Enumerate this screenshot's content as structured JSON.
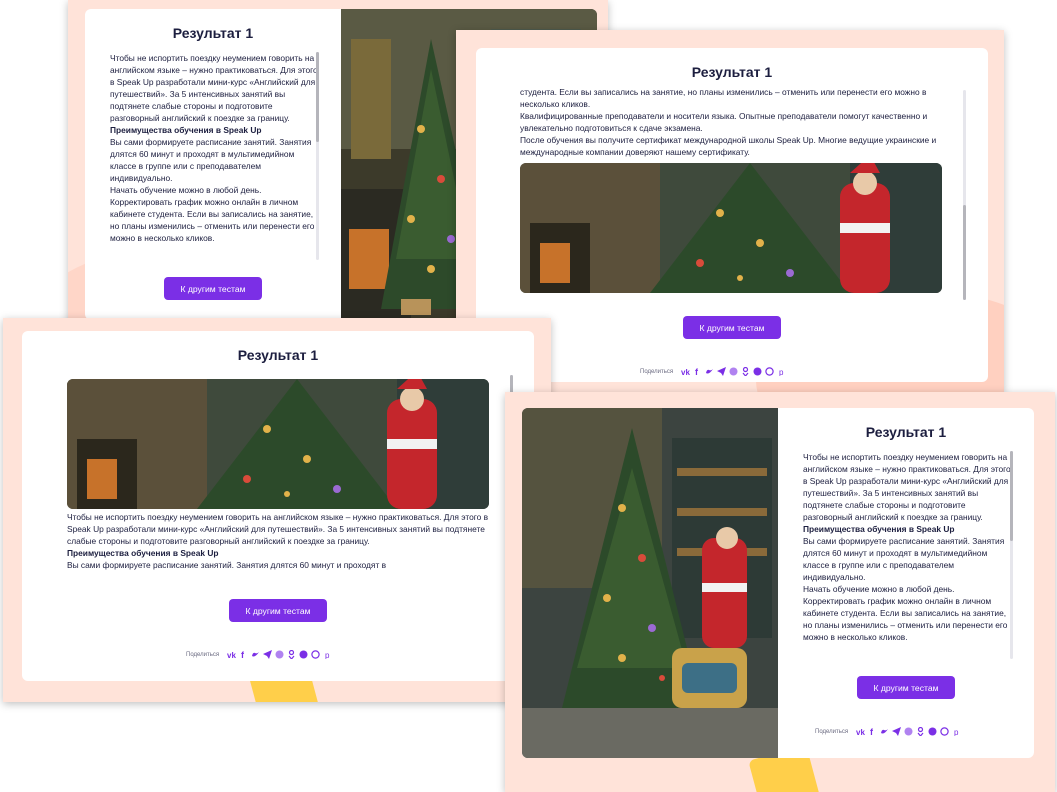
{
  "colors": {
    "accent": "#7b2fe6",
    "frame_bg": "#ffe3d9",
    "text": "#1c1e3f"
  },
  "cards": [
    {
      "title": "Результат 1",
      "button_label": "К другим тестам",
      "paragraphs": [
        "Чтобы не испортить поездку неумением говорить на английском языке – нужно практиковаться. Для этого в Speak Up разработали мини-курс «Английский для путешествий». За 5 интенсивных занятий вы подтянете слабые стороны и подготовите разговорный английский к поездке за границу.",
        "Преимущества обучения в Speak Up",
        "Вы сами формируете расписание занятий. Занятия длятся 60 минут и проходят в мультимедийном классе в группе или с преподавателем индивидуально.",
        "Начать обучение можно в любой день. Корректировать график можно онлайн в личном кабинете студента. Если вы записались на занятие, но планы изменились – отменить или перенести его можно в несколько кликов."
      ]
    },
    {
      "title": "Результат 1",
      "button_label": "К другим тестам",
      "share_label": "Поделиться",
      "paragraphs": [
        "студента. Если вы записались на занятие, но планы изменились – отменить или перенести его можно в несколько кликов.",
        "Квалифицированные преподаватели и носители языка. Опытные преподаватели помогут качественно и увлекательно подготовиться к сдаче экзамена.",
        "После обучения вы получите сертификат международной школы Speak Up. Многие ведущие украинские и международные компании доверяют нашему сертификату."
      ]
    },
    {
      "title": "Результат 1",
      "button_label": "К другим тестам",
      "share_label": "Поделиться",
      "paragraphs": [
        "Чтобы не испортить поездку неумением говорить на английском языке – нужно практиковаться. Для этого в Speak Up разработали мини-курс «Английский для путешествий». За 5 интенсивных занятий вы подтянете слабые стороны и подготовите разговорный английский к поездке за границу.",
        "Преимущества обучения в Speak Up",
        "Вы сами формируете расписание занятий. Занятия длятся 60 минут и проходят в"
      ]
    },
    {
      "title": "Результат 1",
      "button_label": "К другим тестам",
      "share_label": "Поделиться",
      "paragraphs": [
        "Чтобы не испортить поездку неумением говорить на английском языке – нужно практиковаться. Для этого в Speak Up разработали мини-курс «Английский для путешествий». За 5 интенсивных занятий вы подтянете слабые стороны и подготовите разговорный английский к поездке за границу.",
        "Преимущества обучения в Speak Up",
        "Вы сами формируете расписание занятий. Занятия длятся 60 минут и проходят в мультимедийном классе в группе или с преподавателем индивидуально.",
        "Начать обучение можно в любой день. Корректировать график можно онлайн в личном кабинете студента. Если вы записались на занятие, но планы изменились – отменить или перенести его можно в несколько кликов."
      ]
    }
  ],
  "share_icons": [
    "vk-icon",
    "facebook-icon",
    "twitter-icon",
    "telegram-icon",
    "viber-alt-icon",
    "odnoklassniki-icon",
    "viber-icon",
    "whatsapp-icon",
    "pinterest-icon"
  ]
}
